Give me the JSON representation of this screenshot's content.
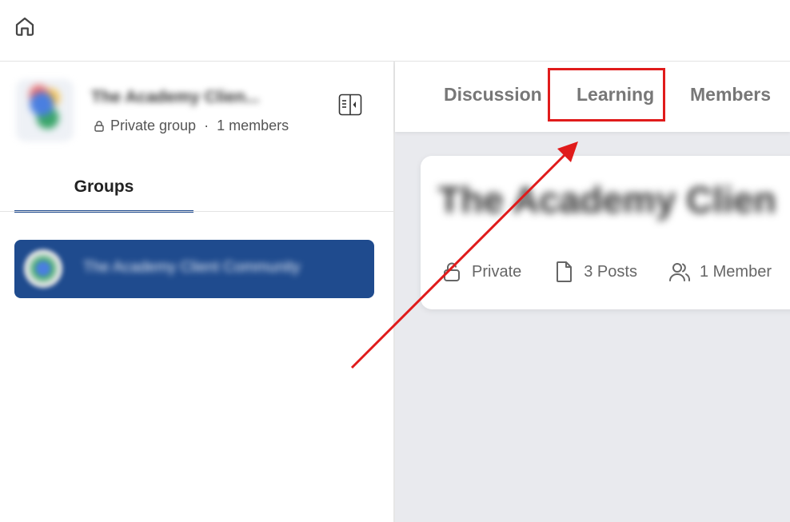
{
  "header": {
    "home_icon": "home-icon"
  },
  "sidebar": {
    "group_name": "The Academy Clien...",
    "privacy_label": "Private group",
    "separator": "·",
    "members_label": "1 members",
    "collapse_icon": "sidebar-collapse-icon",
    "groups_tab_label": "Groups",
    "group_items": [
      {
        "name": "The Academy Client Community"
      }
    ]
  },
  "main": {
    "tabs": [
      {
        "label": "Discussion"
      },
      {
        "label": "Learning"
      },
      {
        "label": "Members"
      }
    ],
    "card": {
      "title": "The Academy Clien",
      "privacy": "Private",
      "posts": "3 Posts",
      "members": "1 Member"
    }
  },
  "annotation": {
    "highlight_color": "#e01b1b",
    "highlighted_tab": "Learning"
  },
  "colors": {
    "accent": "#1f4b8e",
    "background": "#e9eaee"
  }
}
